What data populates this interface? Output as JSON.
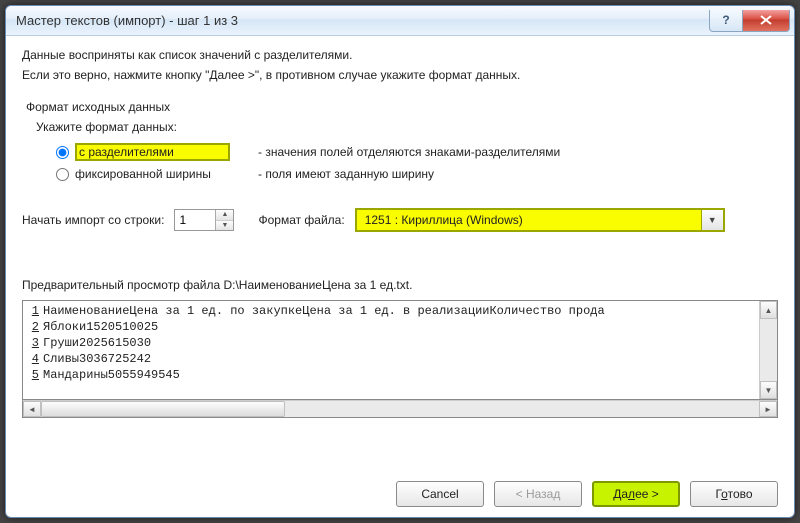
{
  "window": {
    "title": "Мастер текстов (импорт) - шаг 1 из 3"
  },
  "intro": {
    "line1": "Данные восприняты как список значений с разделителями.",
    "line2": "Если это верно, нажмите кнопку \"Далее >\", в противном случае укажите формат данных."
  },
  "format_group": {
    "title": "Формат исходных данных",
    "subtitle": "Укажите формат данных:",
    "options": [
      {
        "label": "с разделителями",
        "desc": "- значения полей отделяются знаками-разделителями",
        "checked": true
      },
      {
        "label": "фиксированной ширины",
        "desc": "- поля имеют заданную ширину",
        "checked": false
      }
    ]
  },
  "import_row": {
    "start_label": "Начать импорт со строки:",
    "start_value": "1",
    "file_format_label": "Формат файла:",
    "file_format_value": "1251 : Кириллица (Windows)"
  },
  "preview": {
    "label": "Предварительный просмотр файла D:\\НаименованиеЦена за 1 ед.txt.",
    "lines": [
      "НаименованиеЦена за 1 ед. по закупкеЦена за 1 ед. в реализацииКоличество прода",
      "Яблоки1520510025",
      "Груши2025615030",
      "Сливы3036725242",
      "Мандарины5055949545"
    ]
  },
  "buttons": {
    "cancel": "Cancel",
    "back": "< Назад",
    "next": "Далее >",
    "finish_pre": "Г",
    "finish_ul": "о",
    "finish_post": "тово"
  }
}
